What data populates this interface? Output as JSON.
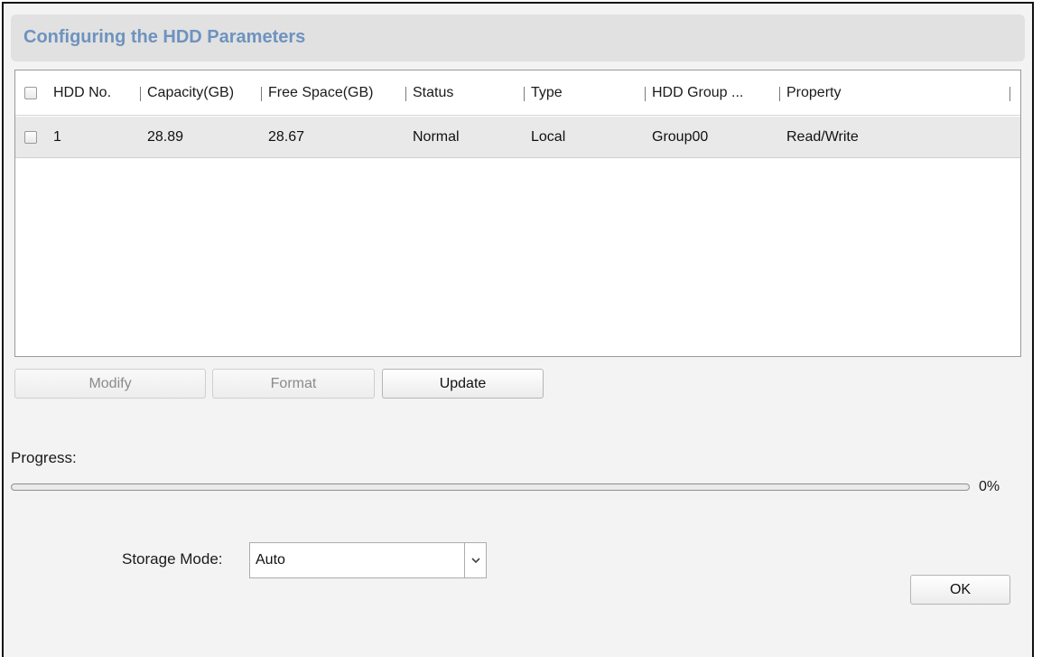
{
  "dialog": {
    "title": "Configuring the HDD Parameters"
  },
  "table": {
    "columns": [
      "HDD No.",
      "Capacity(GB)",
      "Free Space(GB)",
      "Status",
      "Type",
      "HDD Group ...",
      "Property"
    ],
    "rows": [
      {
        "hdd_no": "1",
        "capacity": "28.89",
        "free_space": "28.67",
        "status": "Normal",
        "type": "Local",
        "group": "Group00",
        "property": "Read/Write"
      }
    ]
  },
  "buttons": {
    "modify": "Modify",
    "format": "Format",
    "update": "Update",
    "ok": "OK"
  },
  "progress": {
    "label": "Progress:",
    "value_text": "0%",
    "fraction": 0
  },
  "storage": {
    "label": "Storage Mode:",
    "selected": "Auto"
  },
  "icons": {
    "dropdown": "chevron-down-icon"
  }
}
